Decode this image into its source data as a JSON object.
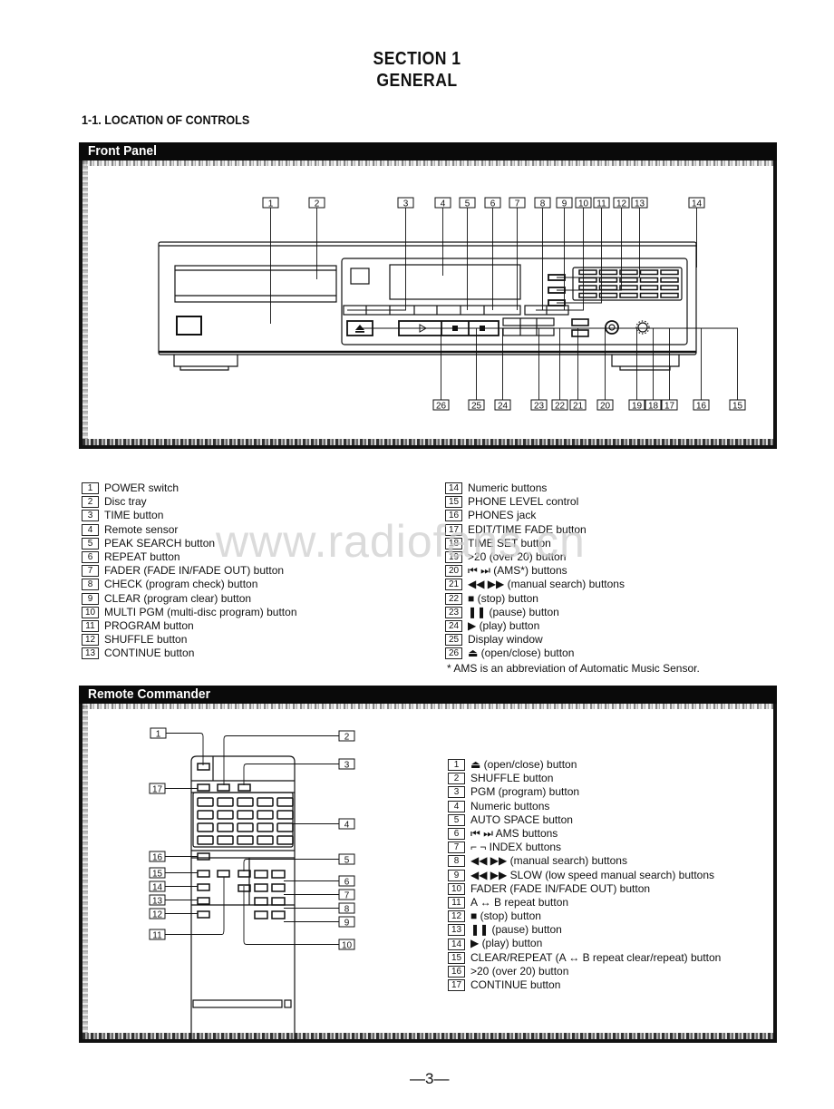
{
  "header": {
    "section": "SECTION 1",
    "title": "GENERAL",
    "subsection": "1-1.  LOCATION OF CONTROLS"
  },
  "front_panel": {
    "heading": "Front Panel",
    "diagram_callouts_top": [
      "1",
      "2",
      "3",
      "4",
      "5",
      "6",
      "7",
      "8",
      "9",
      "10",
      "11",
      "12",
      "13",
      "14"
    ],
    "diagram_callouts_bottom": [
      "26",
      "25",
      "24",
      "23",
      "22",
      "21",
      "20",
      "19",
      "18",
      "17",
      "16",
      "15"
    ],
    "items": [
      {
        "num": "1",
        "label": "POWER switch"
      },
      {
        "num": "2",
        "label": "Disc tray"
      },
      {
        "num": "3",
        "label": "TIME button"
      },
      {
        "num": "4",
        "label": "Remote sensor"
      },
      {
        "num": "5",
        "label": "PEAK SEARCH button"
      },
      {
        "num": "6",
        "label": "REPEAT button"
      },
      {
        "num": "7",
        "label": "FADER (FADE IN/FADE OUT) button"
      },
      {
        "num": "8",
        "label": "CHECK (program check) button"
      },
      {
        "num": "9",
        "label": "CLEAR (program clear) button"
      },
      {
        "num": "10",
        "label": "MULTI PGM (multi-disc program) button"
      },
      {
        "num": "11",
        "label": "PROGRAM button"
      },
      {
        "num": "12",
        "label": "SHUFFLE button"
      },
      {
        "num": "13",
        "label": "CONTINUE button"
      },
      {
        "num": "14",
        "label": "Numeric buttons"
      },
      {
        "num": "15",
        "label": "PHONE LEVEL control"
      },
      {
        "num": "16",
        "label": "PHONES jack"
      },
      {
        "num": "17",
        "label": "EDIT/TIME FADE button"
      },
      {
        "num": "18",
        "label": "TIME SET button"
      },
      {
        "num": "19",
        "label": ">20 (over 20) button"
      },
      {
        "num": "20",
        "label": "⏮ ⏭ (AMS*) buttons"
      },
      {
        "num": "21",
        "label": "◀◀ ▶▶ (manual search) buttons"
      },
      {
        "num": "22",
        "label": "■ (stop) button"
      },
      {
        "num": "23",
        "label": "❚❚ (pause) button"
      },
      {
        "num": "24",
        "label": "▶ (play) button"
      },
      {
        "num": "25",
        "label": "Display window"
      },
      {
        "num": "26",
        "label": "⏏ (open/close) button"
      }
    ],
    "footnote": "*  AMS is an abbreviation of Automatic Music Sensor."
  },
  "remote_commander": {
    "heading": "Remote Commander",
    "items": [
      {
        "num": "1",
        "label": "⏏ (open/close) button"
      },
      {
        "num": "2",
        "label": "SHUFFLE button"
      },
      {
        "num": "3",
        "label": "PGM (program) button"
      },
      {
        "num": "4",
        "label": "Numeric buttons"
      },
      {
        "num": "5",
        "label": "AUTO SPACE button"
      },
      {
        "num": "6",
        "label": "⏮ ⏭ AMS buttons"
      },
      {
        "num": "7",
        "label": "⌐ ¬ INDEX buttons"
      },
      {
        "num": "8",
        "label": "◀◀ ▶▶ (manual search) buttons"
      },
      {
        "num": "9",
        "label": "◀◀ ▶▶ SLOW (low speed manual search) buttons"
      },
      {
        "num": "10",
        "label": "FADER (FADE IN/FADE OUT) button"
      },
      {
        "num": "11",
        "label": "A ↔ B repeat button"
      },
      {
        "num": "12",
        "label": "■ (stop) button"
      },
      {
        "num": "13",
        "label": "❚❚ (pause) button"
      },
      {
        "num": "14",
        "label": "▶ (play) button"
      },
      {
        "num": "15",
        "label": "CLEAR/REPEAT (A ↔ B repeat clear/repeat) button"
      },
      {
        "num": "16",
        "label": ">20 (over 20) button"
      },
      {
        "num": "17",
        "label": "CONTINUE button"
      }
    ]
  },
  "watermark": "www.radiofans.cn",
  "page_number": "—3—"
}
